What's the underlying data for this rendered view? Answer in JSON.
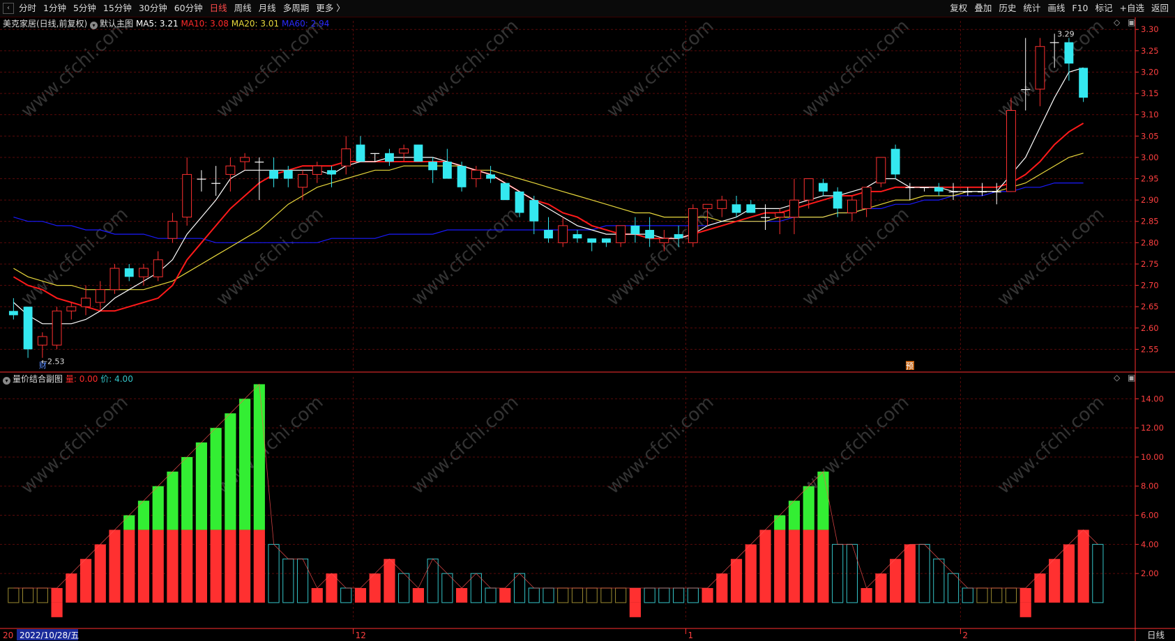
{
  "toolbar": {
    "periods": [
      "分时",
      "1分钟",
      "5分钟",
      "15分钟",
      "30分钟",
      "60分钟",
      "日线",
      "周线",
      "月线",
      "多周期",
      "更多 〉"
    ],
    "active_period": "日线",
    "actions": [
      "复权",
      "叠加",
      "历史",
      "统计",
      "画线",
      "F10",
      "标记",
      "+自选",
      "返回"
    ]
  },
  "colors": {
    "up": "#ff3030",
    "down": "#34e8f0",
    "ma5": "#ffffff",
    "ma10": "#ff1a1a",
    "ma20": "#e8d83c",
    "ma60": "#1a1aff",
    "grid": "#5a0a0a",
    "axis": "#ff3030",
    "green": "#33ee33",
    "teal": "#34c4c8",
    "olive": "#9a8a30"
  },
  "main_legend": {
    "title": "美克家居(日线,前复权)",
    "subtitle": "默认主图",
    "ma5": "MA5: 3.21",
    "ma10": "MA10: 3.08",
    "ma20": "MA20: 3.01",
    "ma60": "MA60: 2.94"
  },
  "sub_legend": {
    "title": "量价结合副图",
    "liang": "量: 0.00",
    "jia": "价: 4.00"
  },
  "annotations": {
    "low": "←2.53",
    "high": "3.29",
    "cai": "财",
    "yu": "预"
  },
  "bottom": {
    "date": "2022/10/28/五",
    "month_12": "12",
    "month_1": "1",
    "month_2": "2",
    "prefix": "20",
    "period": "日线"
  },
  "watermark": "www.cfchi.com",
  "chart_data": [
    {
      "type": "candlestick",
      "title": "美克家居(日线,前复权)",
      "ylim": [
        2.5,
        3.32
      ],
      "y_ticks": [
        "3.30",
        "3.25",
        "3.20",
        "3.15",
        "3.10",
        "3.05",
        "3.00",
        "2.95",
        "2.90",
        "2.85",
        "2.80",
        "2.75",
        "2.70",
        "2.65",
        "2.60",
        "2.55"
      ],
      "candles": [
        [
          2.64,
          2.67,
          2.62,
          2.63
        ],
        [
          2.65,
          2.65,
          2.53,
          2.55
        ],
        [
          2.56,
          2.59,
          2.53,
          2.58
        ],
        [
          2.56,
          2.65,
          2.55,
          2.64
        ],
        [
          2.64,
          2.66,
          2.62,
          2.65
        ],
        [
          2.65,
          2.7,
          2.63,
          2.67
        ],
        [
          2.66,
          2.71,
          2.64,
          2.69
        ],
        [
          2.69,
          2.75,
          2.68,
          2.74
        ],
        [
          2.74,
          2.75,
          2.71,
          2.72
        ],
        [
          2.72,
          2.75,
          2.7,
          2.74
        ],
        [
          2.72,
          2.78,
          2.71,
          2.76
        ],
        [
          2.81,
          2.87,
          2.8,
          2.85
        ],
        [
          2.86,
          3.0,
          2.84,
          2.96
        ],
        [
          2.95,
          2.97,
          2.92,
          2.95
        ],
        [
          2.94,
          2.98,
          2.91,
          2.94
        ],
        [
          2.96,
          3.0,
          2.92,
          2.98
        ],
        [
          2.99,
          3.01,
          2.97,
          3.0
        ],
        [
          2.99,
          3.0,
          2.9,
          2.99
        ],
        [
          2.97,
          3.0,
          2.93,
          2.95
        ],
        [
          2.97,
          2.98,
          2.93,
          2.95
        ],
        [
          2.93,
          2.97,
          2.9,
          2.96
        ],
        [
          2.96,
          2.99,
          2.94,
          2.98
        ],
        [
          2.97,
          2.98,
          2.93,
          2.96
        ],
        [
          2.98,
          3.05,
          2.96,
          3.02
        ],
        [
          3.03,
          3.05,
          2.99,
          2.99
        ],
        [
          3.01,
          3.01,
          2.99,
          3.01
        ],
        [
          3.01,
          3.02,
          2.98,
          2.99
        ],
        [
          3.01,
          3.03,
          2.99,
          3.02
        ],
        [
          3.03,
          3.03,
          2.99,
          2.99
        ],
        [
          2.99,
          3.0,
          2.94,
          2.97
        ],
        [
          2.99,
          3.02,
          2.95,
          2.95
        ],
        [
          2.98,
          2.99,
          2.92,
          2.93
        ],
        [
          2.95,
          2.98,
          2.93,
          2.97
        ],
        [
          2.96,
          2.98,
          2.94,
          2.95
        ],
        [
          2.94,
          2.94,
          2.9,
          2.9
        ],
        [
          2.92,
          2.92,
          2.86,
          2.87
        ],
        [
          2.9,
          2.91,
          2.82,
          2.85
        ],
        [
          2.83,
          2.86,
          2.8,
          2.81
        ],
        [
          2.8,
          2.86,
          2.79,
          2.84
        ],
        [
          2.82,
          2.83,
          2.8,
          2.81
        ],
        [
          2.81,
          2.81,
          2.78,
          2.8
        ],
        [
          2.81,
          2.81,
          2.79,
          2.8
        ],
        [
          2.8,
          2.84,
          2.79,
          2.84
        ],
        [
          2.84,
          2.86,
          2.8,
          2.82
        ],
        [
          2.83,
          2.86,
          2.79,
          2.81
        ],
        [
          2.8,
          2.83,
          2.78,
          2.81
        ],
        [
          2.82,
          2.84,
          2.79,
          2.81
        ],
        [
          2.8,
          2.89,
          2.79,
          2.88
        ],
        [
          2.88,
          2.89,
          2.84,
          2.89
        ],
        [
          2.88,
          2.91,
          2.86,
          2.9
        ],
        [
          2.89,
          2.91,
          2.86,
          2.87
        ],
        [
          2.89,
          2.9,
          2.87,
          2.87
        ],
        [
          2.86,
          2.89,
          2.83,
          2.86
        ],
        [
          2.86,
          2.88,
          2.82,
          2.87
        ],
        [
          2.86,
          2.95,
          2.82,
          2.9
        ],
        [
          2.9,
          2.95,
          2.88,
          2.95
        ],
        [
          2.94,
          2.95,
          2.91,
          2.92
        ],
        [
          2.92,
          2.93,
          2.86,
          2.88
        ],
        [
          2.87,
          2.91,
          2.85,
          2.9
        ],
        [
          2.88,
          2.93,
          2.86,
          2.93
        ],
        [
          2.94,
          3.0,
          2.93,
          3.0
        ],
        [
          3.02,
          3.03,
          2.95,
          2.96
        ],
        [
          2.93,
          2.94,
          2.9,
          2.93
        ],
        [
          2.93,
          2.93,
          2.92,
          2.93
        ],
        [
          2.93,
          2.94,
          2.91,
          2.92
        ],
        [
          2.92,
          2.94,
          2.9,
          2.92
        ],
        [
          2.92,
          2.93,
          2.91,
          2.92
        ],
        [
          2.92,
          2.94,
          2.91,
          2.92
        ],
        [
          2.92,
          2.94,
          2.89,
          2.92
        ],
        [
          2.92,
          3.14,
          2.92,
          3.11
        ],
        [
          3.16,
          3.28,
          3.11,
          3.16
        ],
        [
          3.16,
          3.28,
          3.12,
          3.26
        ],
        [
          3.27,
          3.29,
          3.21,
          3.27
        ],
        [
          3.27,
          3.28,
          3.18,
          3.22
        ],
        [
          3.21,
          3.21,
          3.13,
          3.14
        ]
      ],
      "ma5": [
        2.66,
        2.63,
        2.61,
        2.61,
        2.61,
        2.62,
        2.64,
        2.67,
        2.69,
        2.71,
        2.73,
        2.76,
        2.82,
        2.86,
        2.9,
        2.95,
        2.97,
        2.97,
        2.97,
        2.97,
        2.97,
        2.97,
        2.96,
        2.98,
        2.99,
        2.99,
        3.0,
        3.0,
        3.0,
        3.0,
        2.99,
        2.98,
        2.97,
        2.96,
        2.94,
        2.92,
        2.9,
        2.88,
        2.86,
        2.84,
        2.83,
        2.82,
        2.82,
        2.82,
        2.82,
        2.81,
        2.81,
        2.82,
        2.84,
        2.85,
        2.86,
        2.88,
        2.88,
        2.88,
        2.89,
        2.9,
        2.91,
        2.91,
        2.92,
        2.93,
        2.95,
        2.95,
        2.93,
        2.93,
        2.93,
        2.92,
        2.92,
        2.92,
        2.92,
        2.96,
        3.0,
        3.07,
        3.14,
        3.2,
        3.21
      ],
      "ma10": [
        2.72,
        2.7,
        2.69,
        2.67,
        2.66,
        2.65,
        2.64,
        2.64,
        2.65,
        2.66,
        2.67,
        2.7,
        2.76,
        2.8,
        2.84,
        2.88,
        2.91,
        2.94,
        2.96,
        2.97,
        2.98,
        2.98,
        2.98,
        2.99,
        2.99,
        2.99,
        2.99,
        2.99,
        2.99,
        2.99,
        2.99,
        2.98,
        2.97,
        2.96,
        2.94,
        2.92,
        2.9,
        2.89,
        2.87,
        2.86,
        2.84,
        2.83,
        2.82,
        2.82,
        2.81,
        2.81,
        2.81,
        2.82,
        2.83,
        2.84,
        2.85,
        2.86,
        2.87,
        2.87,
        2.88,
        2.89,
        2.9,
        2.91,
        2.91,
        2.92,
        2.92,
        2.93,
        2.93,
        2.93,
        2.93,
        2.93,
        2.93,
        2.93,
        2.93,
        2.94,
        2.96,
        2.99,
        3.03,
        3.06,
        3.08
      ],
      "ma20": [
        2.74,
        2.72,
        2.71,
        2.7,
        2.7,
        2.69,
        2.69,
        2.69,
        2.69,
        2.69,
        2.7,
        2.71,
        2.73,
        2.75,
        2.77,
        2.79,
        2.81,
        2.83,
        2.86,
        2.89,
        2.91,
        2.93,
        2.94,
        2.95,
        2.96,
        2.97,
        2.97,
        2.98,
        2.98,
        2.98,
        2.98,
        2.98,
        2.97,
        2.97,
        2.96,
        2.95,
        2.94,
        2.93,
        2.92,
        2.91,
        2.9,
        2.89,
        2.88,
        2.87,
        2.87,
        2.86,
        2.86,
        2.86,
        2.86,
        2.85,
        2.85,
        2.85,
        2.85,
        2.86,
        2.86,
        2.86,
        2.86,
        2.87,
        2.87,
        2.88,
        2.89,
        2.9,
        2.9,
        2.91,
        2.91,
        2.91,
        2.92,
        2.92,
        2.92,
        2.93,
        2.94,
        2.96,
        2.98,
        3.0,
        3.01
      ],
      "ma60": [
        2.86,
        2.85,
        2.85,
        2.84,
        2.84,
        2.83,
        2.83,
        2.82,
        2.82,
        2.82,
        2.81,
        2.81,
        2.81,
        2.81,
        2.8,
        2.8,
        2.8,
        2.8,
        2.8,
        2.8,
        2.8,
        2.8,
        2.81,
        2.81,
        2.81,
        2.81,
        2.82,
        2.82,
        2.82,
        2.82,
        2.83,
        2.83,
        2.83,
        2.83,
        2.83,
        2.83,
        2.83,
        2.83,
        2.83,
        2.83,
        2.83,
        2.84,
        2.84,
        2.84,
        2.84,
        2.84,
        2.84,
        2.84,
        2.84,
        2.85,
        2.85,
        2.85,
        2.85,
        2.85,
        2.86,
        2.86,
        2.86,
        2.87,
        2.87,
        2.88,
        2.88,
        2.89,
        2.89,
        2.9,
        2.9,
        2.91,
        2.91,
        2.91,
        2.92,
        2.92,
        2.93,
        2.93,
        2.94,
        2.94,
        2.94
      ]
    },
    {
      "type": "bar",
      "title": "量价结合副图",
      "ylim": [
        -1.2,
        15.5
      ],
      "y_ticks": [
        "14.00",
        "12.00",
        "10.00",
        "8.00",
        "6.00",
        "4.00",
        "2.00"
      ],
      "bars": [
        {
          "k": "o",
          "v": 1
        },
        {
          "k": "o",
          "v": 1
        },
        {
          "k": "o",
          "v": 1
        },
        {
          "k": "r",
          "v": 1,
          "n": 1
        },
        {
          "k": "r",
          "v": 2
        },
        {
          "k": "r",
          "v": 3
        },
        {
          "k": "r",
          "v": 4
        },
        {
          "k": "r",
          "v": 5
        },
        {
          "k": "r",
          "v": 5,
          "g": 6
        },
        {
          "k": "r",
          "v": 5,
          "g": 7
        },
        {
          "k": "r",
          "v": 5,
          "g": 8
        },
        {
          "k": "r",
          "v": 5,
          "g": 9
        },
        {
          "k": "r",
          "v": 5,
          "g": 10
        },
        {
          "k": "r",
          "v": 5,
          "g": 11
        },
        {
          "k": "r",
          "v": 5,
          "g": 12
        },
        {
          "k": "r",
          "v": 5,
          "g": 13
        },
        {
          "k": "r",
          "v": 5,
          "g": 14
        },
        {
          "k": "r",
          "v": 5,
          "g": 15
        },
        {
          "k": "c",
          "v": 4
        },
        {
          "k": "c",
          "v": 3
        },
        {
          "k": "c",
          "v": 3
        },
        {
          "k": "r",
          "v": 1
        },
        {
          "k": "r",
          "v": 2
        },
        {
          "k": "c",
          "v": 1
        },
        {
          "k": "r",
          "v": 1
        },
        {
          "k": "r",
          "v": 2
        },
        {
          "k": "r",
          "v": 3
        },
        {
          "k": "c",
          "v": 2
        },
        {
          "k": "r",
          "v": 1
        },
        {
          "k": "c",
          "v": 3
        },
        {
          "k": "c",
          "v": 2
        },
        {
          "k": "r",
          "v": 1
        },
        {
          "k": "c",
          "v": 2
        },
        {
          "k": "c",
          "v": 1
        },
        {
          "k": "r",
          "v": 1
        },
        {
          "k": "c",
          "v": 2
        },
        {
          "k": "c",
          "v": 1
        },
        {
          "k": "c",
          "v": 1
        },
        {
          "k": "o",
          "v": 1
        },
        {
          "k": "o",
          "v": 1
        },
        {
          "k": "o",
          "v": 1
        },
        {
          "k": "o",
          "v": 1
        },
        {
          "k": "o",
          "v": 1
        },
        {
          "k": "r",
          "v": 1,
          "n": 1
        },
        {
          "k": "c",
          "v": 1
        },
        {
          "k": "c",
          "v": 1
        },
        {
          "k": "c",
          "v": 1
        },
        {
          "k": "c",
          "v": 1
        },
        {
          "k": "r",
          "v": 1
        },
        {
          "k": "r",
          "v": 2
        },
        {
          "k": "r",
          "v": 3
        },
        {
          "k": "r",
          "v": 4
        },
        {
          "k": "r",
          "v": 5
        },
        {
          "k": "r",
          "v": 5,
          "g": 6
        },
        {
          "k": "r",
          "v": 5,
          "g": 7
        },
        {
          "k": "r",
          "v": 5,
          "g": 8
        },
        {
          "k": "r",
          "v": 5,
          "g": 9
        },
        {
          "k": "c",
          "v": 4
        },
        {
          "k": "c",
          "v": 4
        },
        {
          "k": "r",
          "v": 1
        },
        {
          "k": "r",
          "v": 2
        },
        {
          "k": "r",
          "v": 3
        },
        {
          "k": "r",
          "v": 4
        },
        {
          "k": "c",
          "v": 4
        },
        {
          "k": "c",
          "v": 3
        },
        {
          "k": "c",
          "v": 2
        },
        {
          "k": "c",
          "v": 1
        },
        {
          "k": "o",
          "v": 1
        },
        {
          "k": "o",
          "v": 1
        },
        {
          "k": "o",
          "v": 1
        },
        {
          "k": "r",
          "v": 1,
          "n": 1
        },
        {
          "k": "r",
          "v": 2
        },
        {
          "k": "r",
          "v": 3
        },
        {
          "k": "r",
          "v": 4
        },
        {
          "k": "r",
          "v": 5
        },
        {
          "k": "c",
          "v": 4
        }
      ]
    }
  ]
}
